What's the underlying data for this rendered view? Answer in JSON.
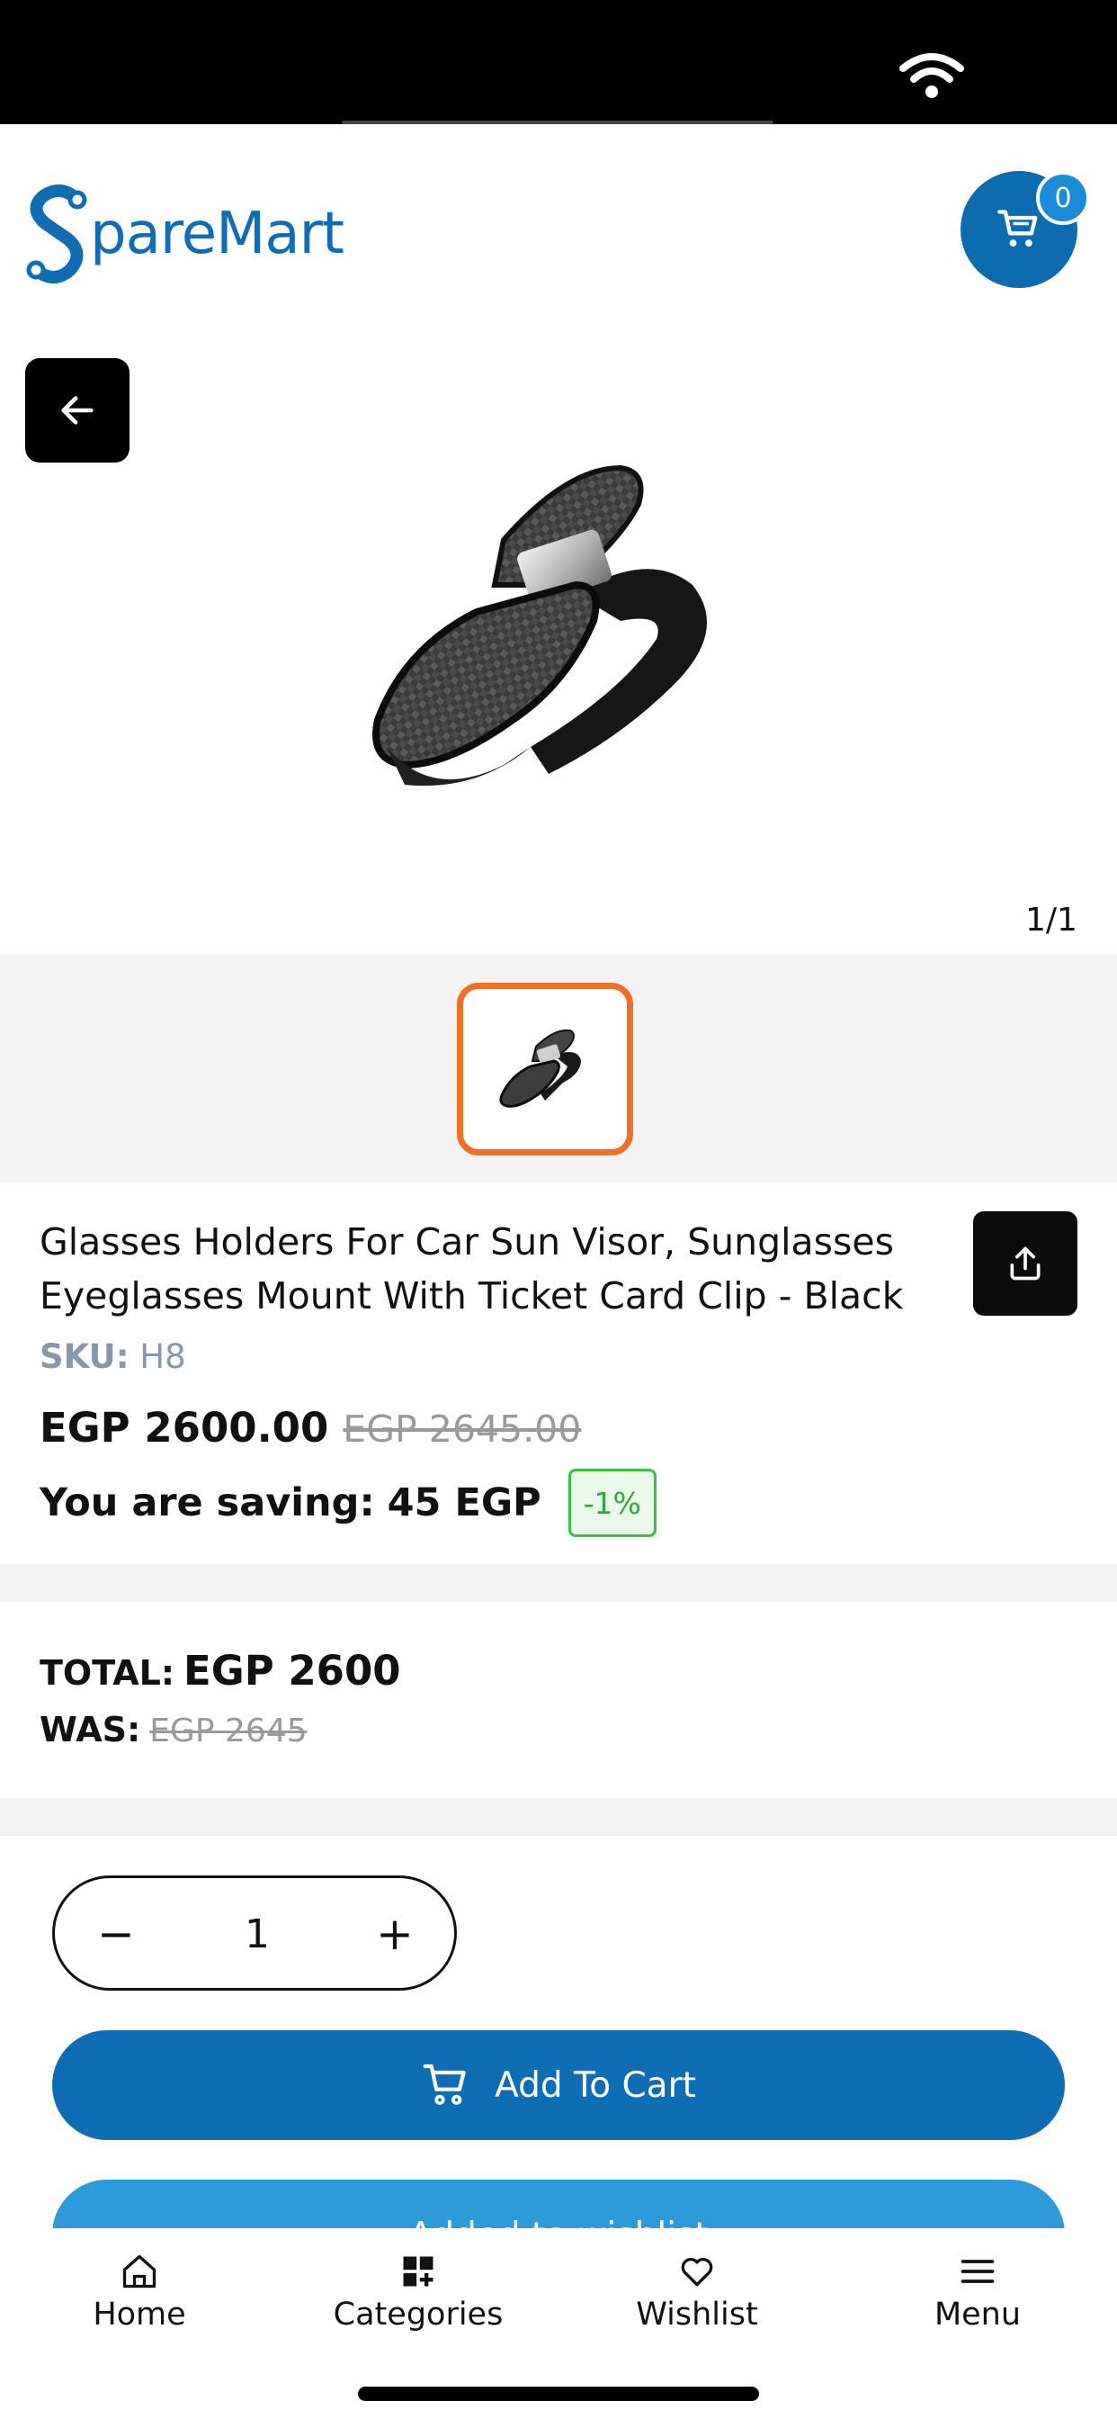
{
  "header": {
    "logo_text": "pareMart",
    "cart_count": "0"
  },
  "gallery": {
    "counter": "1/1"
  },
  "product": {
    "title": "Glasses Holders For Car Sun Visor, Sunglasses Eyeglasses Mount With Ticket Card Clip - Black",
    "sku_label": "SKU:",
    "sku_value": "H8",
    "price": "EGP 2600.00",
    "old_price": "EGP 2645.00",
    "saving_label": "You are saving:",
    "saving_value": "45 EGP",
    "discount": "-1%"
  },
  "totals": {
    "total_label": "TOTAL:",
    "total_value": "EGP 2600",
    "was_label": "WAS:",
    "was_value": "EGP 2645"
  },
  "quantity": {
    "minus": "−",
    "value": "1",
    "plus": "+"
  },
  "actions": {
    "add_to_cart": "Add To Cart",
    "wishlist": "Added to wishlist"
  },
  "nav": {
    "items": [
      {
        "label": "Home",
        "icon": "home-icon"
      },
      {
        "label": "Categories",
        "icon": "categories-icon"
      },
      {
        "label": "Wishlist",
        "icon": "heart-icon"
      },
      {
        "label": "Menu",
        "icon": "menu-icon"
      }
    ]
  },
  "colors": {
    "brand_blue": "#0f6db3",
    "wishlist_blue": "#2c9bd8",
    "thumb_border": "#f07027",
    "discount_green": "#2fa83d"
  }
}
